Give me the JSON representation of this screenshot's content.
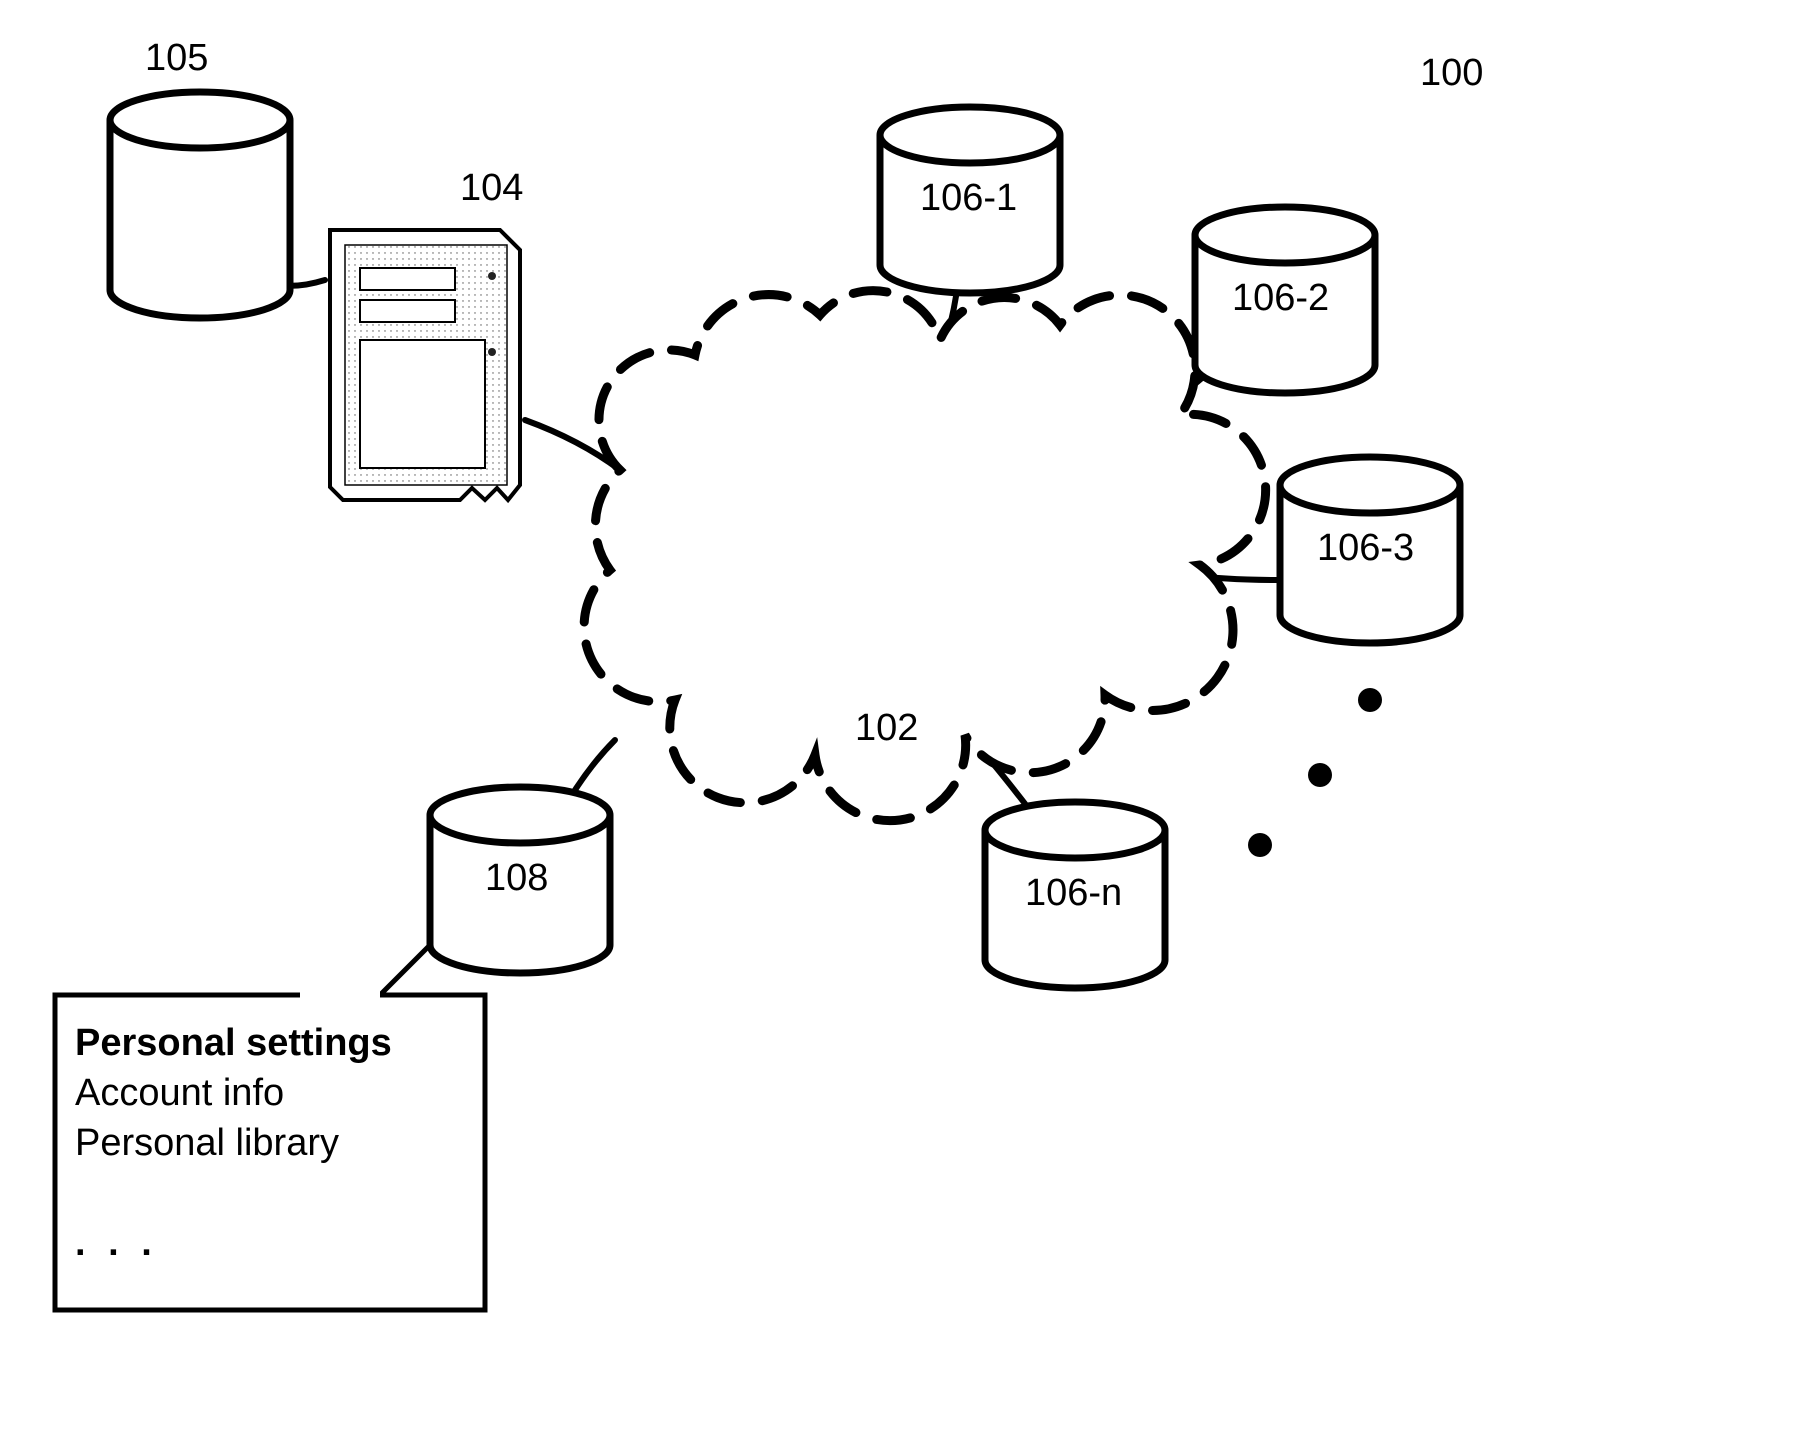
{
  "figure_ref": "100",
  "cloud_ref": "102",
  "server": {
    "ref": "104"
  },
  "server_db": {
    "ref": "105"
  },
  "client_db": {
    "ref": "108"
  },
  "remote_dbs": [
    {
      "ref": "106-1"
    },
    {
      "ref": "106-2"
    },
    {
      "ref": "106-3"
    },
    {
      "ref": "106-n"
    }
  ],
  "callout": {
    "title": "Personal settings",
    "line1": "Account info",
    "line2": "Personal library",
    "ellipsis": ". . ."
  }
}
